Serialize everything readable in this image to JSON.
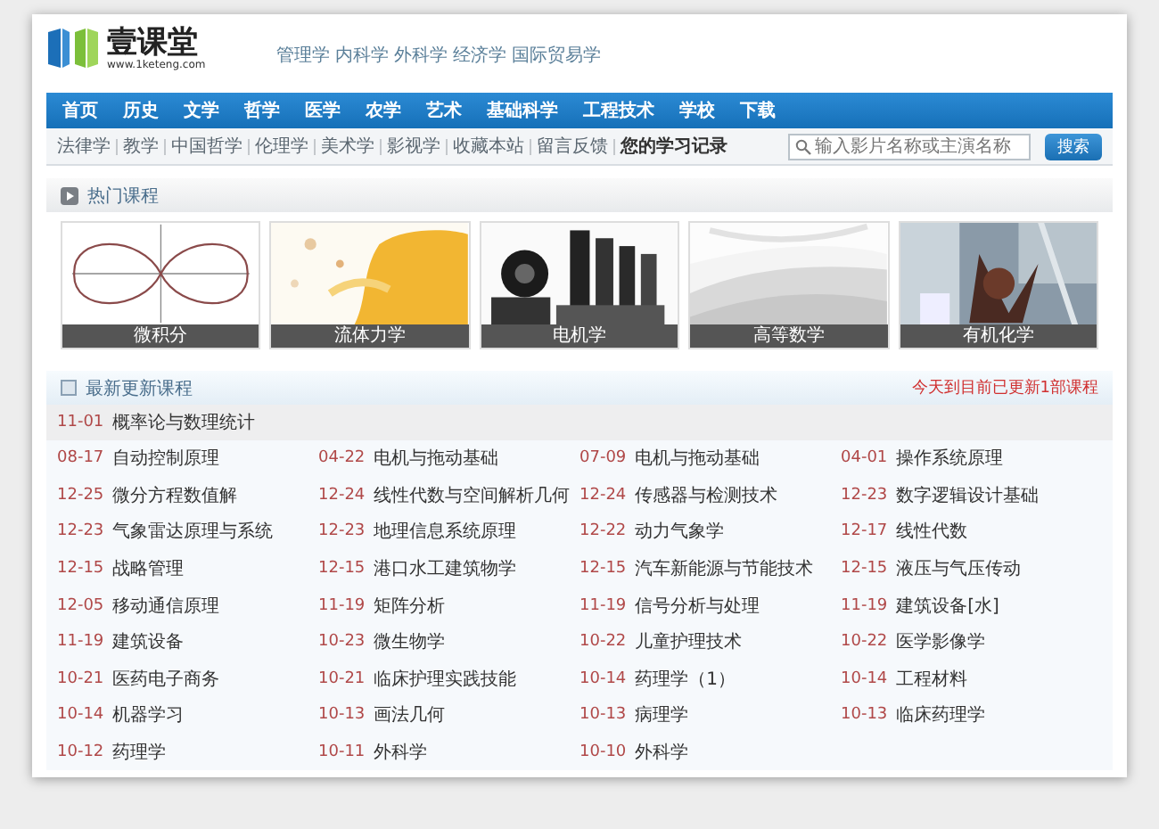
{
  "header": {
    "logo_text": "壹课堂",
    "logo_url": "www.1keteng.com",
    "top_links": [
      "管理学",
      "内科学",
      "外科学",
      "经济学",
      "国际贸易学"
    ]
  },
  "nav": [
    "首页",
    "历史",
    "文学",
    "哲学",
    "医学",
    "农学",
    "艺术",
    "基础科学",
    "工程技术",
    "学校",
    "下载"
  ],
  "sub_nav": {
    "links": [
      "法律学",
      "教学",
      "中国哲学",
      "伦理学",
      "美术学",
      "影视学",
      "收藏本站",
      "留言反馈"
    ],
    "history_link": "您的学习记录"
  },
  "search": {
    "placeholder": "输入影片名称或主演名称",
    "button": "搜索"
  },
  "hot_courses": {
    "title": "热门课程",
    "items": [
      {
        "caption": "微积分",
        "kind": "picture"
      },
      {
        "caption": "流体力学",
        "kind": "picture"
      },
      {
        "caption": "电机学",
        "kind": "picture"
      },
      {
        "caption": "高等数学",
        "kind": "picture"
      },
      {
        "caption": "有机化学",
        "kind": "picture"
      }
    ]
  },
  "latest": {
    "title": "最新更新课程",
    "notice": "今天到目前已更新1部课程",
    "featured": {
      "date": "11-01",
      "title": "概率论与数理统计"
    },
    "rows": [
      [
        {
          "date": "08-17",
          "title": "自动控制原理"
        },
        {
          "date": "04-22",
          "title": "电机与拖动基础"
        },
        {
          "date": "07-09",
          "title": "电机与拖动基础"
        },
        {
          "date": "04-01",
          "title": "操作系统原理"
        }
      ],
      [
        {
          "date": "12-25",
          "title": "微分方程数值解"
        },
        {
          "date": "12-24",
          "title": "线性代数与空间解析几何"
        },
        {
          "date": "12-24",
          "title": "传感器与检测技术"
        },
        {
          "date": "12-23",
          "title": "数字逻辑设计基础"
        }
      ],
      [
        {
          "date": "12-23",
          "title": "气象雷达原理与系统"
        },
        {
          "date": "12-23",
          "title": "地理信息系统原理"
        },
        {
          "date": "12-22",
          "title": "动力气象学"
        },
        {
          "date": "12-17",
          "title": "线性代数"
        }
      ],
      [
        {
          "date": "12-15",
          "title": "战略管理"
        },
        {
          "date": "12-15",
          "title": "港口水工建筑物学"
        },
        {
          "date": "12-15",
          "title": "汽车新能源与节能技术"
        },
        {
          "date": "12-15",
          "title": "液压与气压传动"
        }
      ],
      [
        {
          "date": "12-05",
          "title": "移动通信原理"
        },
        {
          "date": "11-19",
          "title": "矩阵分析"
        },
        {
          "date": "11-19",
          "title": "信号分析与处理"
        },
        {
          "date": "11-19",
          "title": "建筑设备[水]"
        }
      ],
      [
        {
          "date": "11-19",
          "title": "建筑设备"
        },
        {
          "date": "10-23",
          "title": "微生物学"
        },
        {
          "date": "10-22",
          "title": "儿童护理技术"
        },
        {
          "date": "10-22",
          "title": "医学影像学"
        }
      ],
      [
        {
          "date": "10-21",
          "title": "医药电子商务"
        },
        {
          "date": "10-21",
          "title": "临床护理实践技能"
        },
        {
          "date": "10-14",
          "title": "药理学（1）"
        },
        {
          "date": "10-14",
          "title": "工程材料"
        }
      ],
      [
        {
          "date": "10-14",
          "title": "机器学习"
        },
        {
          "date": "10-13",
          "title": "画法几何"
        },
        {
          "date": "10-13",
          "title": "病理学"
        },
        {
          "date": "10-13",
          "title": "临床药理学"
        }
      ],
      [
        {
          "date": "10-12",
          "title": "药理学"
        },
        {
          "date": "10-11",
          "title": "外科学"
        },
        {
          "date": "10-10",
          "title": "外科学"
        }
      ]
    ]
  }
}
